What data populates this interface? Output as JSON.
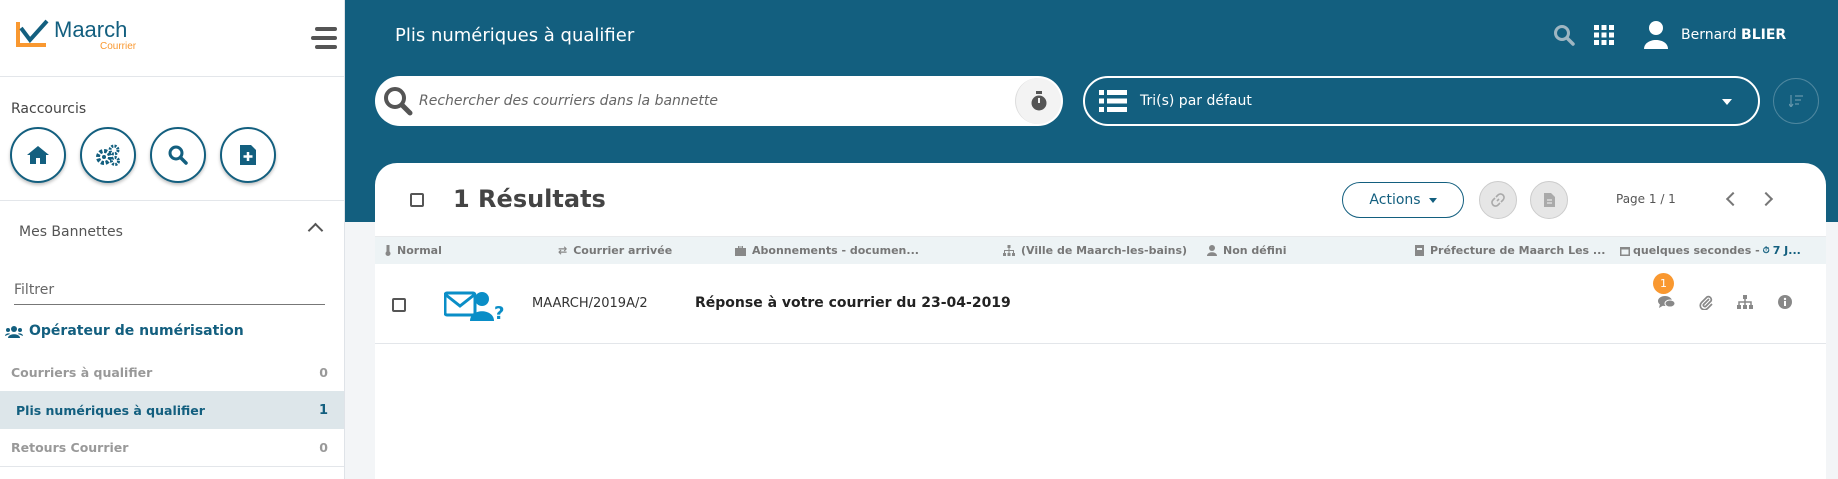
{
  "logo": {
    "name": "Maarch",
    "subtitle": "Courrier"
  },
  "shortcuts": {
    "title": "Raccourcis",
    "items": [
      {
        "icon": "home-icon"
      },
      {
        "icon": "cogs-icon"
      },
      {
        "icon": "search-icon"
      },
      {
        "icon": "new-document-icon"
      }
    ]
  },
  "baskets": {
    "title": "Mes Bannettes",
    "filter_placeholder": "Filtrer",
    "group": "Opérateur de numérisation",
    "items": [
      {
        "label": "Courriers à qualifier",
        "count": "0"
      },
      {
        "label": "Plis numériques à qualifier",
        "count": "1"
      },
      {
        "label": "Retours Courrier",
        "count": "0"
      }
    ]
  },
  "header": {
    "title": "Plis numériques à qualifier",
    "user_first": "Bernard",
    "user_last": "BLIER"
  },
  "search": {
    "placeholder": "Rechercher des courriers dans la bannette"
  },
  "sort": {
    "label": "Tri(s) par défaut"
  },
  "results": {
    "label": "1 Résultats",
    "actions_label": "Actions",
    "page": "Page 1 / 1"
  },
  "mail": {
    "info": {
      "priority": "Normal",
      "category": "Courrier arrivée",
      "doctype": "Abonnements - documen...",
      "entity": "(Ville de Maarch-les-bains)",
      "destination_user": "Non défini",
      "contact": "Préfecture de Maarch Les ...",
      "date": "quelques secondes -",
      "delay": "7 J..."
    },
    "reference": "MAARCH/2019A/2",
    "subject": "Réponse à votre courrier du 23-04-2019",
    "notes_count": "1"
  },
  "colors": {
    "primary": "#135f7f",
    "accent": "#f99830",
    "background": "#f3f5f7"
  }
}
